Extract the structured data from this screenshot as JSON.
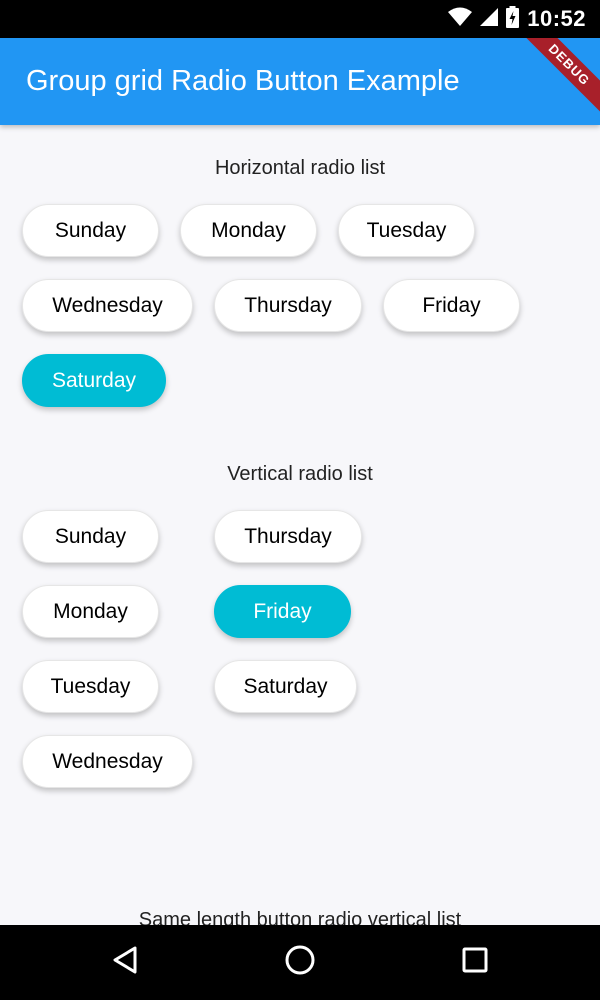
{
  "status_bar": {
    "time": "10:52"
  },
  "app_bar": {
    "title": "Group grid Radio Button Example",
    "debug_label": "DEBUG"
  },
  "horizontal": {
    "title": "Horizontal radio list",
    "selected": "Saturday",
    "items": [
      "Sunday",
      "Monday",
      "Tuesday",
      "Wednesday",
      "Thursday",
      "Friday",
      "Saturday"
    ]
  },
  "vertical": {
    "title": "Vertical radio list",
    "selected": "Friday",
    "items": [
      "Sunday",
      "Monday",
      "Tuesday",
      "Wednesday",
      "Thursday",
      "Friday",
      "Saturday"
    ]
  },
  "same_length": {
    "title": "Same length button radio vertical list"
  },
  "colors": {
    "primary": "#2196f3",
    "selected": "#00bcd4",
    "background": "#f7f7fa"
  },
  "nav_bar": {
    "icons": [
      "back-icon",
      "home-icon",
      "recents-icon"
    ]
  }
}
